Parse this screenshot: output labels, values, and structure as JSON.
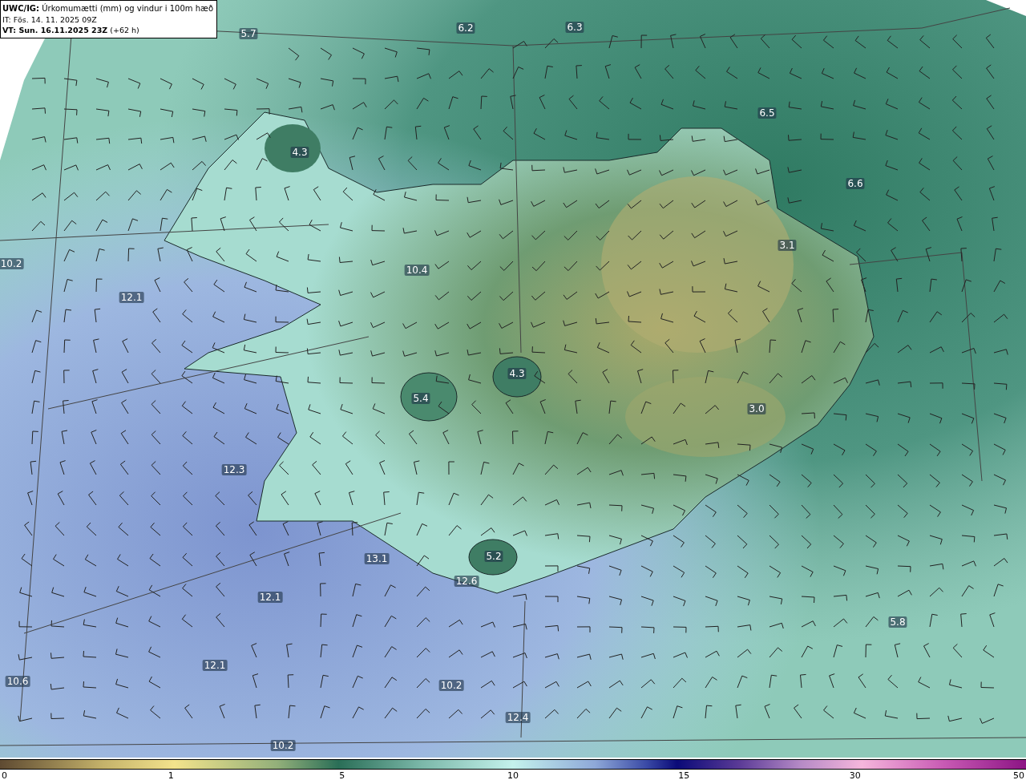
{
  "header": {
    "title": "**UWC/IG:** Úrkomumætti (mm) og vindur i 100m hæð",
    "issue_time": "IT: Fös. 14. 11. 2025 09Z",
    "valid_time": "**VT: Sun. 16.11.2025 23Z** (+62 h)"
  },
  "map_labels": [
    "5.7",
    "6.2",
    "6.3",
    "6.5",
    "4.3",
    "6.6",
    "3.1",
    "10.2",
    "12.1",
    "10.4",
    "4.3",
    "5.4",
    "3.0",
    "12.3",
    "13.1",
    "5.2",
    "12.6",
    "12.1",
    "5.8",
    "12.1",
    "10.6",
    "10.2",
    "12.4",
    "10.2"
  ],
  "colorbar": {
    "ticks": [
      "0",
      "1",
      "5",
      "10",
      "15",
      "30",
      "50"
    ]
  }
}
